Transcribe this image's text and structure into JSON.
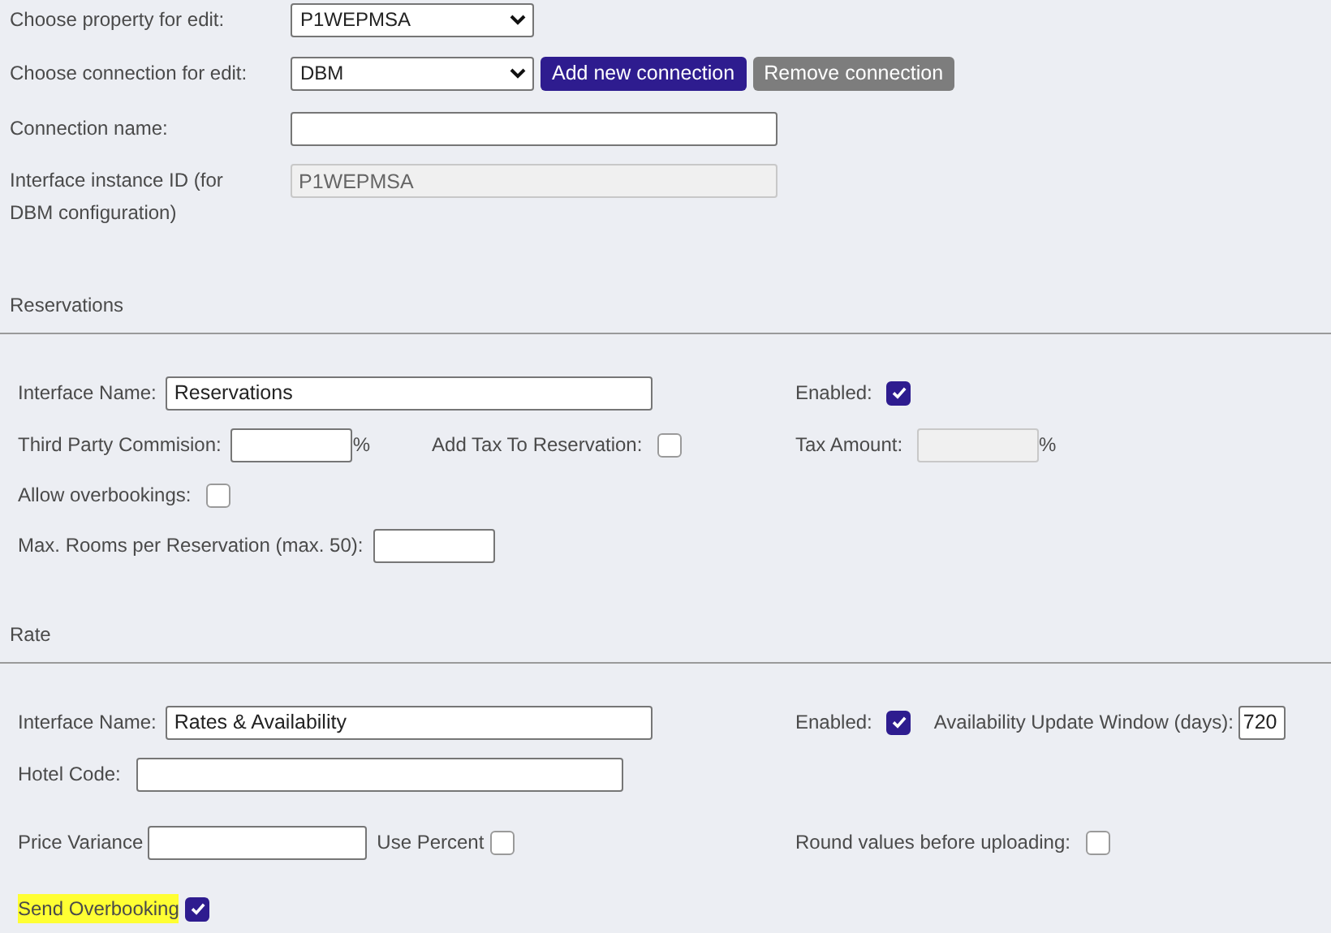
{
  "top": {
    "property": {
      "label": "Choose property for edit:",
      "value": "P1WEPMSA"
    },
    "connection": {
      "label": "Choose connection for edit:",
      "value": "DBM"
    },
    "buttons": [
      {
        "label": "Add new connection",
        "kind": "primary"
      },
      {
        "label": "Remove connection",
        "kind": "secondary"
      }
    ],
    "connection_name": {
      "label": "Connection name:"
    },
    "instance_id": {
      "label": "Interface instance ID (for DBM configuration)",
      "value": "P1WEPMSA",
      "disabled": true
    }
  },
  "reservations": {
    "title": "Reservations",
    "interface_name": {
      "label": "Interface Name:",
      "value": "Reservations"
    },
    "enabled": {
      "label": "Enabled:",
      "checked": true
    },
    "commission": {
      "label": "Third Party Commision:",
      "unit": "%"
    },
    "add_tax": {
      "label": "Add Tax To Reservation:",
      "checked": false
    },
    "tax_amount": {
      "label": "Tax Amount:",
      "unit": "%",
      "disabled": true
    },
    "allow_overbookings": {
      "label": "Allow overbookings:",
      "checked": false
    },
    "max_rooms": {
      "label": "Max. Rooms per Reservation (max. 50):"
    }
  },
  "rate": {
    "title": "Rate",
    "interface_name": {
      "label": "Interface Name:",
      "value": "Rates & Availability"
    },
    "enabled": {
      "label": "Enabled:",
      "checked": true
    },
    "window": {
      "label": "Availability Update Window (days):",
      "value": "720"
    },
    "hotel_code": {
      "label": "Hotel Code:"
    },
    "price_variance": {
      "label": "Price Variance"
    },
    "use_percent": {
      "label": "Use Percent",
      "checked": false
    },
    "round_values": {
      "label": "Round values before uploading:",
      "checked": false
    },
    "send_overbooking": {
      "label": "Send Overbooking",
      "checked": true,
      "highlighted": true
    }
  }
}
